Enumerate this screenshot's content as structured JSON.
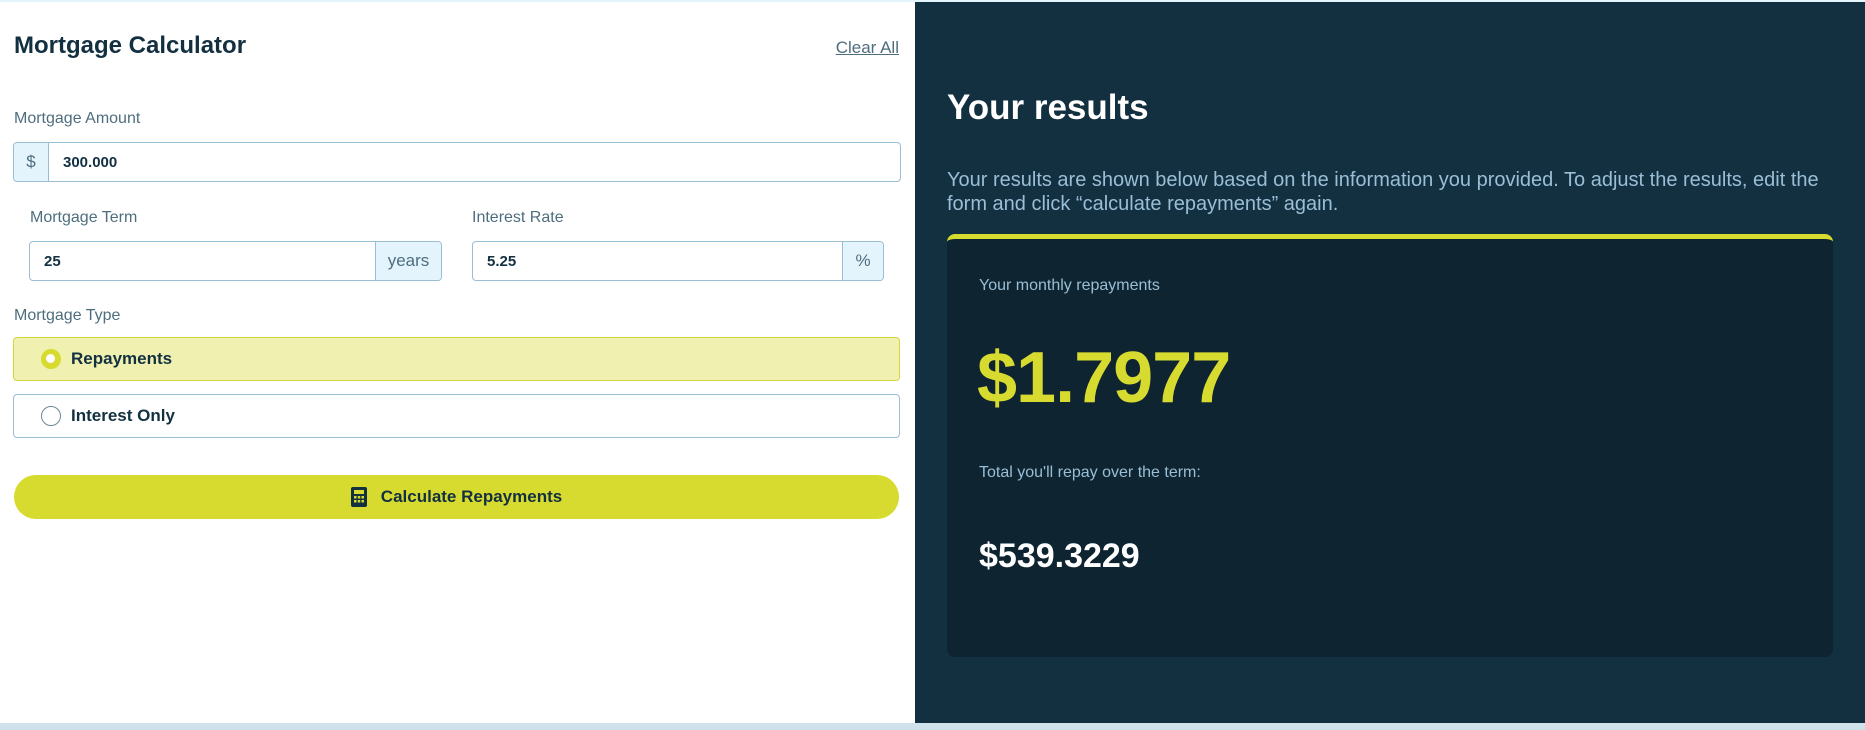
{
  "app": {
    "title": "Mortgage Calculator",
    "clear_label": "Clear All"
  },
  "form": {
    "amount": {
      "label": "Mortgage Amount",
      "prefix": "$",
      "value": "300.000"
    },
    "term": {
      "label": "Mortgage Term",
      "value": "25",
      "suffix": "years"
    },
    "rate": {
      "label": "Interest Rate",
      "value": "5.25",
      "suffix": "%"
    },
    "type": {
      "label": "Mortgage Type",
      "options": [
        {
          "label": "Repayments",
          "selected": true
        },
        {
          "label": "Interest Only",
          "selected": false
        }
      ]
    },
    "submit_label": "Calculate Repayments",
    "submit_icon": "calculator-icon"
  },
  "results": {
    "title": "Your results",
    "description": "Your results are shown below based on the information you provided. To adjust the results, edit the form and click “calculate repayments” again.",
    "monthly_label": "Your monthly repayments",
    "monthly_value": "$1.7977",
    "total_label": "Total you'll repay over the term:",
    "total_value": "$539.3229"
  },
  "colors": {
    "accent": "#d8db2f",
    "dark": "#133041",
    "darker": "#0e2431",
    "muted": "#9abed5"
  }
}
